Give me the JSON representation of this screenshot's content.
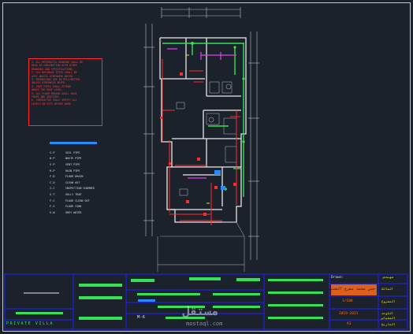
{
  "notes": {
    "lines": [
      "1. ALL MECHANICAL DRAWING SHALL BE",
      "READ IN CONJUNCTION WITH OTHER",
      "DRAWINGS AND SPECIFICATIONS.",
      "2. ALL DRAINAGE PIPES SHALL BE",
      "uPVC UNLESS OTHERWISE NOTED.",
      "3. DIMENSIONS ARE IN MILLIMETERS",
      "UNLESS OTHERWISE NOTED.",
      "4. VENT PIPES SHALL EXTEND",
      "ABOVE THE ROOF LEVEL.",
      "5. ALL FLOOR DRAINS SHALL HAVE",
      "TRAPS AND GRATINGS.",
      "6. CONTRACTOR SHALL VERIFY ALL",
      "LEVELS ON SITE BEFORE WORK."
    ]
  },
  "legend": {
    "rows": [
      {
        "code": "S.P",
        "desc": "SOIL PIPE"
      },
      {
        "code": "W.P",
        "desc": "WASTE PIPE"
      },
      {
        "code": "V.P",
        "desc": "VENT PIPE"
      },
      {
        "code": "R.P",
        "desc": "RAIN PIPE"
      },
      {
        "code": "F.D",
        "desc": "FLOOR DRAIN"
      },
      {
        "code": "C.O",
        "desc": "CLEAN OUT"
      },
      {
        "code": "I.C",
        "desc": "INSPECTION CHAMBER"
      },
      {
        "code": "G.T",
        "desc": "GULLY TRAP"
      },
      {
        "code": "F.C",
        "desc": "FLOOR CLEAN OUT"
      },
      {
        "code": "F.S",
        "desc": "FLOOR SINK"
      },
      {
        "code": "G.W",
        "desc": "GREY WATER"
      }
    ]
  },
  "title_block": {
    "project_name": "PRIVATE VILLA",
    "sheet_label": "M-6",
    "drawing_label": "Drawn:",
    "designer_ar": "حسن محمد مفرح العسيري",
    "stamp_ar": "مهندس",
    "field_labels_ar": [
      "المالك",
      "المشروع",
      "اللوحة",
      "المقياس",
      "التاريخ"
    ],
    "field_values": [
      "1/100",
      "2019-2021",
      "A3"
    ],
    "watermark": "مستقل",
    "watermark_url": "mostaql.com"
  },
  "colors": {
    "background": "#1c222b",
    "wall": "#e8e8e8",
    "drain_red": "#ff2a2a",
    "pipe_green": "#35e055",
    "vent_magenta": "#e040e8",
    "title_blue": "#2020ff",
    "accent_yellow": "#e8e020"
  }
}
